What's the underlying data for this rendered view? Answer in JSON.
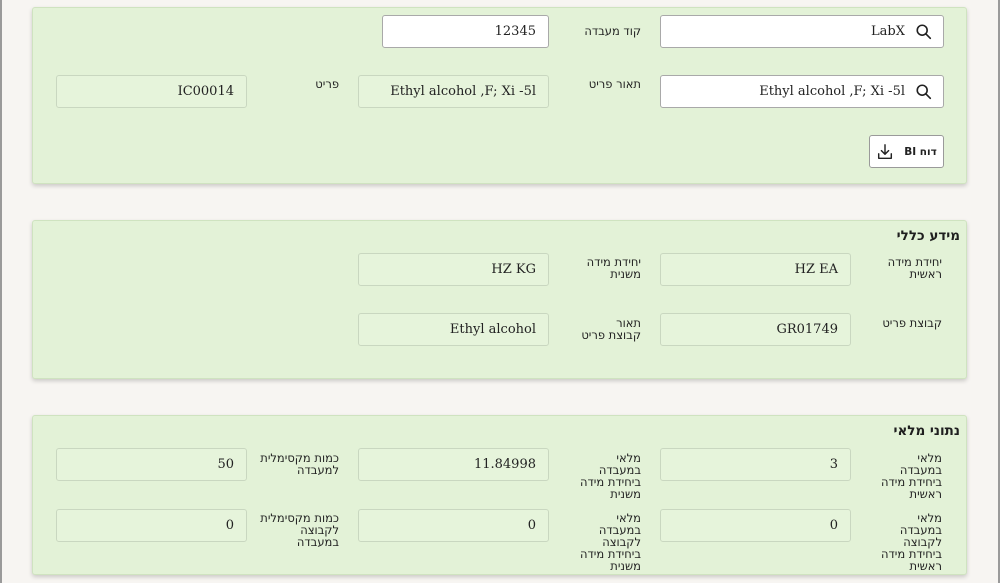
{
  "search": {
    "lab_value": "LabX",
    "lab_code_label": "קוד מעבדה",
    "lab_code_value": "12345",
    "item_search_value": "Ethyl alcohol ,F; Xi -5l",
    "item_desc_label": "תאור פריט",
    "item_desc_value": "Ethyl alcohol ,F; Xi -5l",
    "item_label": "פריט",
    "item_value": "IC00014",
    "bi_button_label": "דוח BI"
  },
  "general_info": {
    "title": "מידע כללי",
    "primary_unit_label": "יחידת מידה ראשית",
    "primary_unit_value": "HZ EA",
    "secondary_unit_label": "יחידת מידה משנית",
    "secondary_unit_value": "HZ KG",
    "item_group_label": "קבוצת פריט",
    "item_group_value": "GR01749",
    "group_desc_label": "תאור קבוצת פריט",
    "group_desc_value": "Ethyl alcohol"
  },
  "stock_data": {
    "title": "נתוני מלאי",
    "lab_stock_primary_label": "מלאי במעבדה ביחידת מידה ראשית",
    "lab_stock_primary_value": "3",
    "lab_stock_secondary_label": "מלאי במעבדה ביחידת מידה משנית",
    "lab_stock_secondary_value": "11.84998",
    "max_lab_qty_label": "כמות מקסימלית למעבדה",
    "max_lab_qty_value": "50",
    "group_stock_primary_label": "מלאי במעבדה לקבוצה ביחידת מידה ראשית",
    "group_stock_primary_value": "0",
    "group_stock_secondary_label": "מלאי במעבדה לקבוצה ביחידת מידה משנית",
    "group_stock_secondary_value": "0",
    "max_group_qty_label": "כמות מקסימלית לקבוצה במעבדה",
    "max_group_qty_value": "0"
  },
  "icons": {
    "search": "search-icon",
    "download": "download-icon"
  },
  "colors": {
    "card_bg": "#e3f2d7",
    "page_bg": "#f7f5f2"
  }
}
